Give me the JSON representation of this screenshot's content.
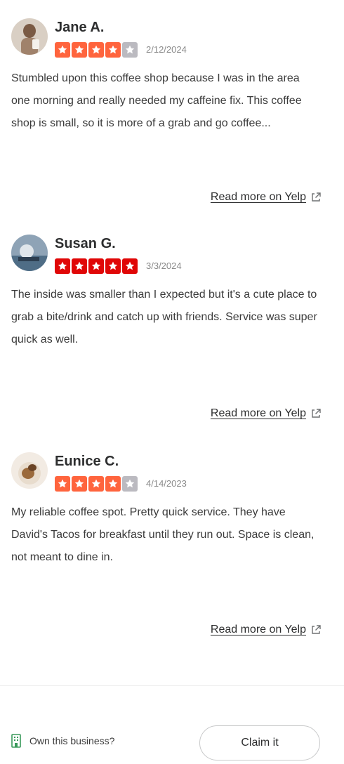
{
  "colors": {
    "star_red": "#e00707",
    "star_orange": "#ff643d",
    "star_empty": "#bbbac0",
    "text": "#2d2e2f",
    "muted": "#8a8a8a"
  },
  "reviews": [
    {
      "author": "Jane A.",
      "rating": 4,
      "date": "2/12/2024",
      "text": "Stumbled upon this coffee shop because I was in the area one morning and really needed my caffeine fix. This coffee shop is small, so it is more of a grab and go coffee...",
      "read_more": "Read more on Yelp",
      "avatar_icon": "user-photo-avatar"
    },
    {
      "author": "Susan G.",
      "rating": 5,
      "date": "3/3/2024",
      "text": "The inside was smaller than I expected but it's a cute place to grab a bite/drink and catch up with friends. Service was super quick as well.",
      "read_more": "Read more on Yelp",
      "avatar_icon": "user-photo-avatar"
    },
    {
      "author": "Eunice C.",
      "rating": 4,
      "date": "4/14/2023",
      "text": "My reliable coffee spot. Pretty quick service. They have David's Tacos for breakfast until they run out. Space is clean, not meant to dine in.",
      "read_more": "Read more on Yelp",
      "avatar_icon": "user-photo-avatar"
    }
  ],
  "footer": {
    "own_business_label": "Own this business?",
    "claim_label": "Claim it",
    "building_icon": "building-icon"
  }
}
